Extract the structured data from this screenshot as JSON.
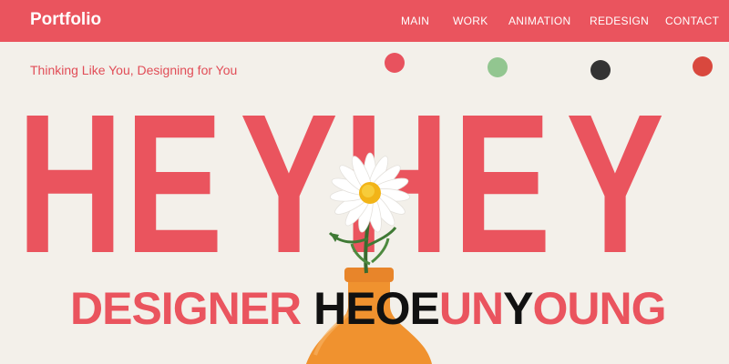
{
  "nav": {
    "brand": "Portfolio",
    "links": [
      "MAIN",
      "WORK",
      "ANIMATION",
      "REDESIGN",
      "CONTACT"
    ]
  },
  "hero": {
    "tagline": "Thinking Like You, Designing for You",
    "title_letters": [
      "H",
      "E",
      "Y",
      "H",
      "E",
      "Y"
    ],
    "subtitle_parts": [
      "DESIGNER",
      " ",
      "HE",
      "OE",
      "UN",
      "Y",
      "OUNG"
    ]
  },
  "dots": [
    "#e8525e",
    "#92c690",
    "#333333",
    "#d9483e"
  ],
  "colors": {
    "accent": "#ea545e",
    "background": "#f3f0ea",
    "text_dark": "#111111",
    "vase": "#f0922f"
  },
  "icons": {
    "flower": "daisy-in-vase-image"
  }
}
